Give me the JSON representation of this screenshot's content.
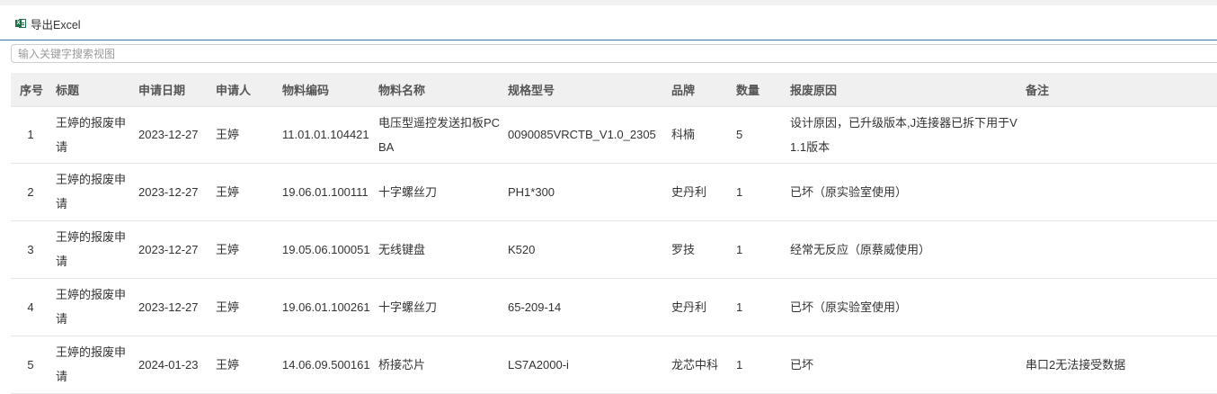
{
  "toolbar": {
    "export_label": "导出Excel",
    "export_icon": "excel-icon"
  },
  "search": {
    "placeholder": "输入关键字搜索视图",
    "value": ""
  },
  "table": {
    "columns": [
      "序号",
      "标题",
      "申请日期",
      "申请人",
      "物料编码",
      "物料名称",
      "规格型号",
      "品牌",
      "数量",
      "报废原因",
      "备注"
    ],
    "rows": [
      {
        "seq": "1",
        "title": "王婷的报废申请",
        "date": "2023-12-27",
        "applicant": "王婷",
        "code": "11.01.01.104421",
        "name": "电压型遥控发送扣板PCBA",
        "spec": "0090085VRCTB_V1.0_2305",
        "brand": "科楠",
        "qty": "5",
        "reason": "设计原因，已升级版本,J连接器已拆下用于V1.1版本",
        "remark": ""
      },
      {
        "seq": "2",
        "title": "王婷的报废申请",
        "date": "2023-12-27",
        "applicant": "王婷",
        "code": "19.06.01.100111",
        "name": "十字螺丝刀",
        "spec": "PH1*300",
        "brand": "史丹利",
        "qty": "1",
        "reason": "已坏（原实验室使用）",
        "remark": ""
      },
      {
        "seq": "3",
        "title": "王婷的报废申请",
        "date": "2023-12-27",
        "applicant": "王婷",
        "code": "19.05.06.100051",
        "name": "无线键盘",
        "spec": "K520",
        "brand": "罗技",
        "qty": "1",
        "reason": "经常无反应（原蔡威使用）",
        "remark": ""
      },
      {
        "seq": "4",
        "title": "王婷的报废申请",
        "date": "2023-12-27",
        "applicant": "王婷",
        "code": "19.06.01.100261",
        "name": "十字螺丝刀",
        "spec": "65-209-14",
        "brand": "史丹利",
        "qty": "1",
        "reason": "已坏（原实验室使用）",
        "remark": ""
      },
      {
        "seq": "5",
        "title": "王婷的报废申请",
        "date": "2024-01-23",
        "applicant": "王婷",
        "code": "14.06.09.500161",
        "name": "桥接芯片",
        "spec": "LS7A2000-i",
        "brand": "龙芯中科",
        "qty": "1",
        "reason": "已坏",
        "remark": "串口2无法接受数据"
      }
    ]
  }
}
